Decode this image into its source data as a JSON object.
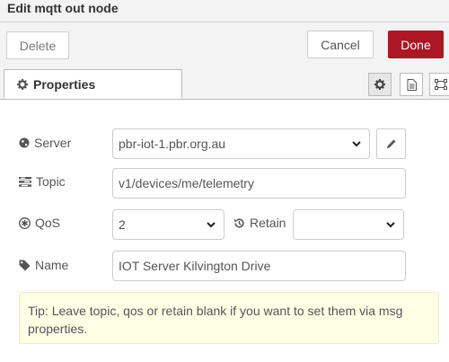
{
  "dialog": {
    "title": "Edit mqtt out node"
  },
  "toolbar": {
    "delete_label": "Delete",
    "cancel_label": "Cancel",
    "done_label": "Done"
  },
  "tabs": [
    {
      "label": "Properties",
      "icon": "gear-icon"
    }
  ],
  "tab_actions": [
    "gear-icon",
    "document-icon",
    "frame-icon"
  ],
  "form": {
    "server": {
      "label": "Server",
      "value": "pbr-iot-1.pbr.org.au",
      "icon": "globe-icon"
    },
    "topic": {
      "label": "Topic",
      "value": "v1/devices/me/telemetry",
      "icon": "tasks-icon"
    },
    "qos": {
      "label": "QoS",
      "value": "2",
      "icon": "asterisk-circle-icon"
    },
    "retain": {
      "label": "Retain",
      "value": "",
      "icon": "history-icon"
    },
    "name": {
      "label": "Name",
      "value": "IOT Server Kilvington Drive",
      "icon": "tag-icon"
    }
  },
  "tip": {
    "text": "Tip: Leave topic, qos or retain blank if you want to set them via msg properties."
  },
  "colors": {
    "primary": "#ad1625",
    "tip_bg": "#ffffe6",
    "header_bg": "#f3f3f3"
  }
}
